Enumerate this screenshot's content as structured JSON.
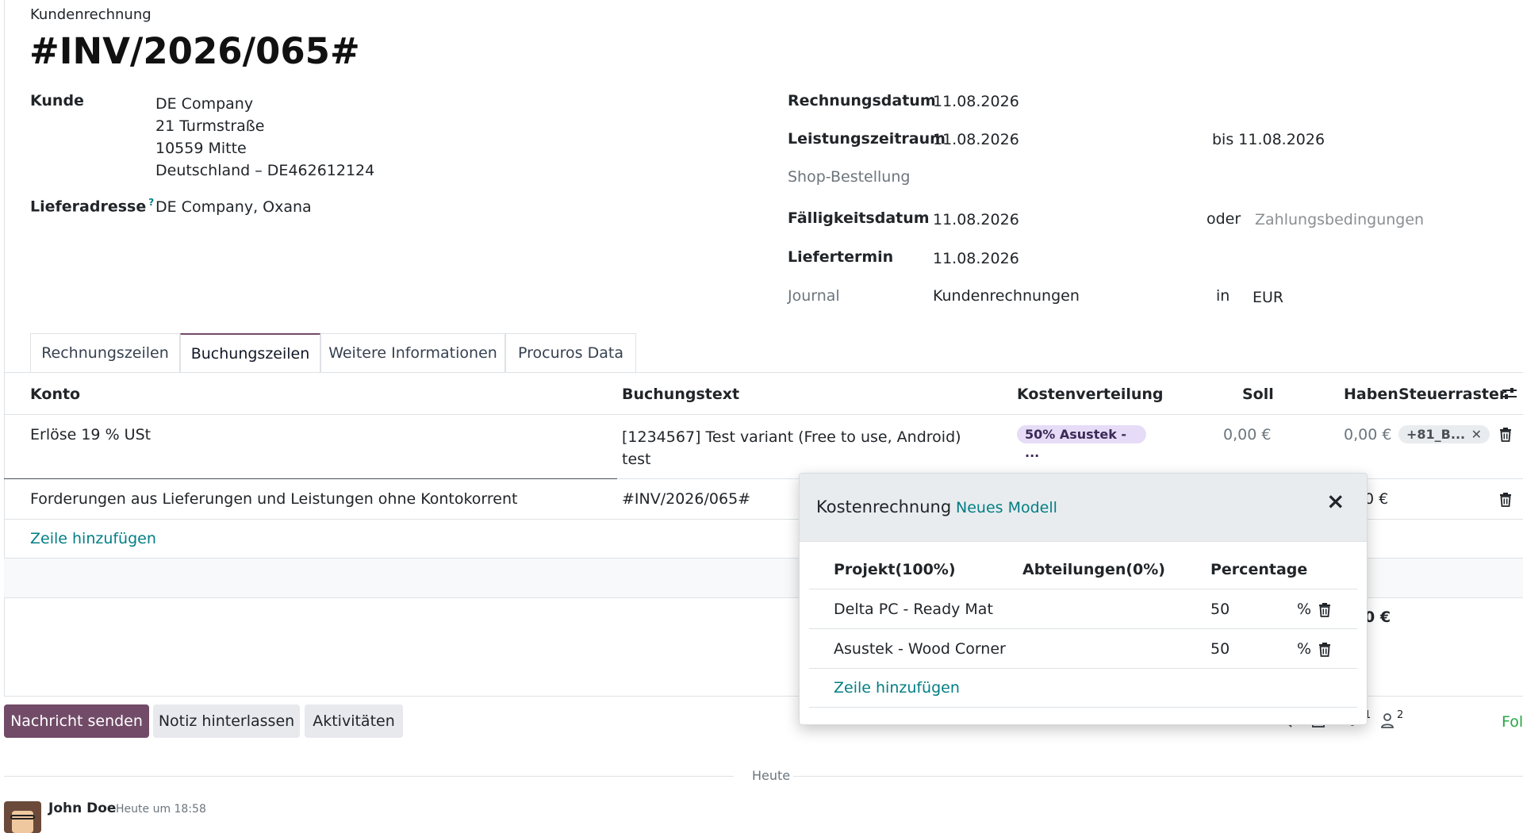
{
  "header": {
    "doc_type": "Kundenrechnung",
    "invoice_number": "#INV/2026/065#"
  },
  "partner": {
    "label": "Kunde",
    "address_lines": [
      "DE Company",
      "21 Turmstraße",
      "10559 Mitte",
      "Deutschland – DE462612124"
    ],
    "delivery_label": "Lieferadresse",
    "delivery_help": "?",
    "delivery_value": "DE Company, Oxana"
  },
  "dates": {
    "invoice_date_label": "Rechnungsdatum",
    "invoice_date": "11.08.2026",
    "service_period_label": "Leistungszeitraum",
    "service_period_from": "11.08.2026",
    "service_period_to": "bis 11.08.2026",
    "shop_order_label": "Shop-Bestellung",
    "due_date_label": "Fälligkeitsdatum",
    "due_date": "11.08.2026",
    "or_label": "oder",
    "payment_terms_placeholder": "Zahlungsbedingungen",
    "delivery_date_label": "Liefertermin",
    "delivery_date": "11.08.2026",
    "journal_label": "Journal",
    "journal": "Kundenrechnungen",
    "in_label": "in",
    "currency": "EUR"
  },
  "tabs": [
    {
      "label": "Rechnungszeilen",
      "active": false
    },
    {
      "label": "Buchungszeilen",
      "active": true
    },
    {
      "label": "Weitere Informationen",
      "active": false
    },
    {
      "label": "Procuros Data",
      "active": false
    }
  ],
  "lines_table": {
    "columns": [
      "Konto",
      "Buchungstext",
      "Kostenverteilung",
      "Soll",
      "Haben",
      "Steuerraster"
    ],
    "rows": [
      {
        "account": "Erlöse 19 % USt",
        "label_line1": "[1234567] Test variant (Free to use, Android)",
        "label_line2": "test",
        "analytic_tag": "50% Asustek - ...",
        "debit": "0,00 €",
        "credit": "0,00 €",
        "tax_tag": "+81_B..."
      },
      {
        "account": "Forderungen aus Lieferungen und Leistungen ohne Kontokorrent",
        "label": "#INV/2026/065#",
        "credit_partial": "0 €"
      }
    ],
    "add_line": "Zeile hinzufügen",
    "total_partial": "0 €"
  },
  "popup": {
    "title": "Kostenrechnung",
    "new_model": "Neues Modell",
    "close": "×",
    "columns": [
      "Projekt(100%)",
      "Abteilungen(0%)",
      "Percentage"
    ],
    "rows": [
      {
        "project": "Delta PC - Ready Mat",
        "percentage": "50",
        "unit": "%"
      },
      {
        "project": "Asustek - Wood Corner",
        "percentage": "50",
        "unit": "%"
      }
    ],
    "add_line": "Zeile hinzufügen"
  },
  "chatter": {
    "send_message": "Nachricht senden",
    "log_note": "Notiz hinterlassen",
    "activities": "Aktivitäten",
    "attachments_count": "1",
    "followers_count": "2",
    "follow_partial": "Fol",
    "date_separator": "Heute",
    "author": "John Doe",
    "timestamp": "Heute um 18:58"
  },
  "colors": {
    "primary": "#714b67",
    "link": "#017e84",
    "analytic_tag_bg": "#e6dcf7",
    "tax_tag_bg": "#e9ecef"
  }
}
